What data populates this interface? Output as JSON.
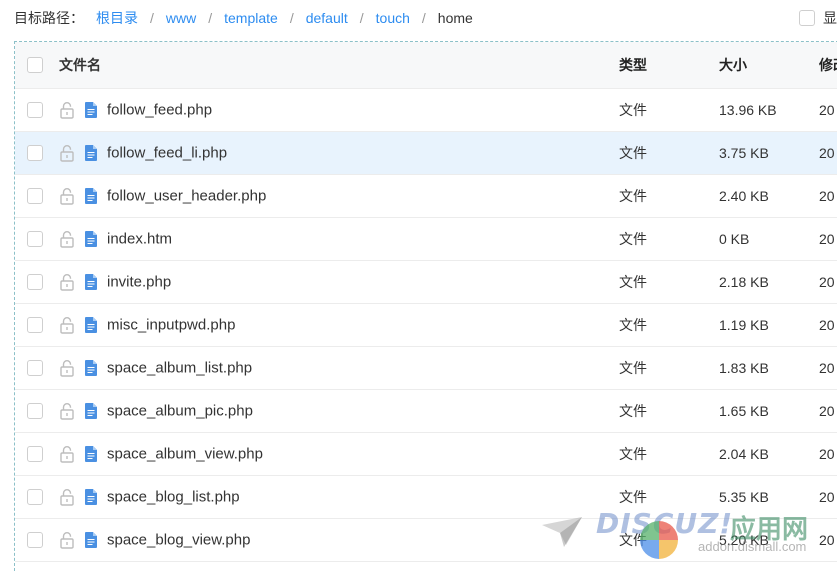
{
  "breadcrumb": {
    "label": "目标路径：",
    "items": [
      "根目录",
      "www",
      "template",
      "default",
      "touch",
      "home"
    ],
    "separator": "/"
  },
  "right_option": {
    "label": "显"
  },
  "table": {
    "headers": {
      "name": "文件名",
      "type": "类型",
      "size": "大小",
      "mtime": "修改"
    },
    "rows": [
      {
        "name": "follow_feed.php",
        "type": "文件",
        "size": "13.96 KB",
        "mtime": "20"
      },
      {
        "name": "follow_feed_li.php",
        "type": "文件",
        "size": "3.75 KB",
        "mtime": "20",
        "selected": true
      },
      {
        "name": "follow_user_header.php",
        "type": "文件",
        "size": "2.40 KB",
        "mtime": "20"
      },
      {
        "name": "index.htm",
        "type": "文件",
        "size": "0 KB",
        "mtime": "20"
      },
      {
        "name": "invite.php",
        "type": "文件",
        "size": "2.18 KB",
        "mtime": "20"
      },
      {
        "name": "misc_inputpwd.php",
        "type": "文件",
        "size": "1.19 KB",
        "mtime": "20"
      },
      {
        "name": "space_album_list.php",
        "type": "文件",
        "size": "1.83 KB",
        "mtime": "20"
      },
      {
        "name": "space_album_pic.php",
        "type": "文件",
        "size": "1.65 KB",
        "mtime": "20"
      },
      {
        "name": "space_album_view.php",
        "type": "文件",
        "size": "2.04 KB",
        "mtime": "20"
      },
      {
        "name": "space_blog_list.php",
        "type": "文件",
        "size": "5.35 KB",
        "mtime": "20"
      },
      {
        "name": "space_blog_view.php",
        "type": "文件",
        "size": "5.20 KB",
        "mtime": "20"
      }
    ]
  },
  "watermark": {
    "brand": "DISCUZ!",
    "cn": "应用网",
    "url": "addon.dismall.com"
  },
  "colors": {
    "link": "#2d8cf0",
    "file_icon": "#4a90e2",
    "selected_row": "#e8f3fd",
    "header_bg": "#f7f8f9"
  },
  "icons": {
    "lock": "unlocked-padlock-icon",
    "file": "file-document-icon"
  }
}
